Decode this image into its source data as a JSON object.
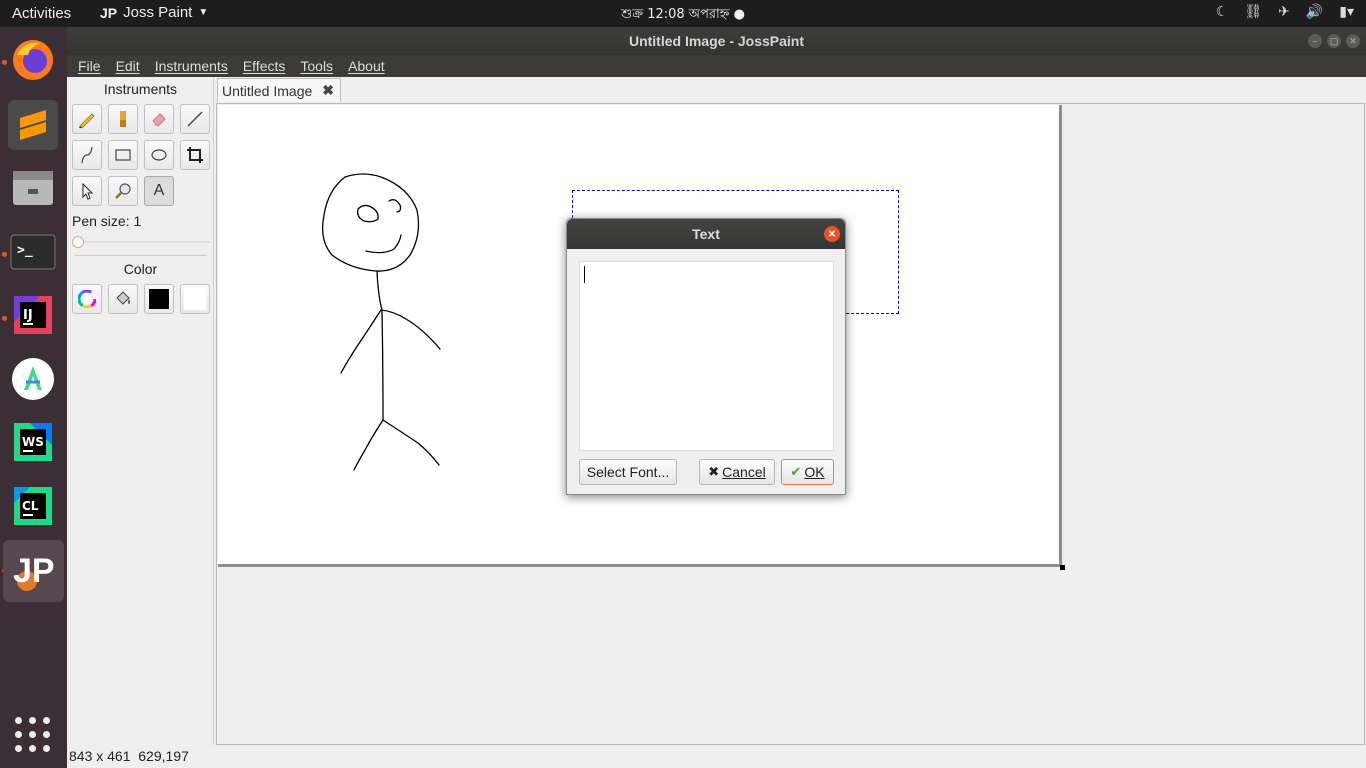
{
  "topbar": {
    "activities": "Activities",
    "app_name": "Joss Paint",
    "app_logo": "JP",
    "clock": "শুক্র 12:08 অপরাহ্ন ●",
    "tray_icons": [
      "night-light-icon",
      "network-icon",
      "airplane-icon",
      "volume-icon",
      "battery-icon"
    ]
  },
  "dock": {
    "items": [
      "firefox",
      "sublime-text",
      "files",
      "terminal",
      "intellij-idea",
      "android-studio",
      "webstorm",
      "clion",
      "josspaint"
    ]
  },
  "window": {
    "title": "Untitled Image - JossPaint"
  },
  "menu": {
    "file": "File",
    "edit": "Edit",
    "instruments": "Instruments",
    "effects": "Effects",
    "tools": "Tools",
    "about": "About"
  },
  "panel": {
    "instruments_title": "Instruments",
    "pen_size_label": "Pen size: 1",
    "pen_size": 1,
    "color_title": "Color",
    "text_tool_glyph": "A",
    "primary_color": "#000000",
    "secondary_color": "#ffffff"
  },
  "tab": {
    "label": "Untitled Image"
  },
  "dialog": {
    "title": "Text",
    "text_value": "",
    "select_font": "Select Font...",
    "cancel": "Cancel",
    "ok": "OK"
  },
  "status": {
    "size_and_pos": "843 x 461  629,197"
  }
}
